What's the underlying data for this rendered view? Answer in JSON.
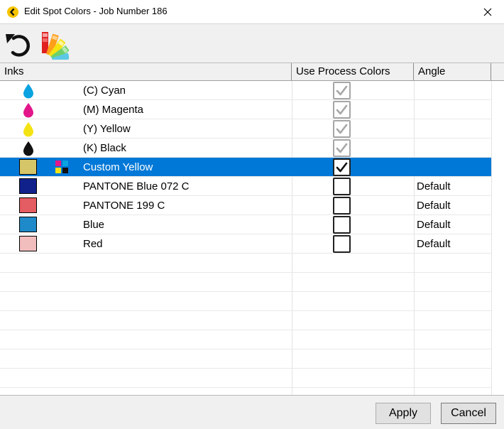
{
  "window": {
    "title": "Edit Spot Colors - Job Number 186",
    "app_icon": "kodak-logo-icon",
    "close_icon": "close-icon"
  },
  "toolbar": {
    "undo_icon": "undo-icon",
    "color_fan_icon": "color-fan-icon"
  },
  "table": {
    "columns": [
      "Inks",
      "Use Process Colors",
      "Angle"
    ],
    "rows": [
      {
        "name": "(C) Cyan",
        "kind": "drop",
        "color": "#0aa2e0",
        "use_process": true,
        "process_enabled": false,
        "angle": "",
        "selected": false
      },
      {
        "name": "(M) Magenta",
        "kind": "drop",
        "color": "#e2168a",
        "use_process": true,
        "process_enabled": false,
        "angle": "",
        "selected": false
      },
      {
        "name": "(Y) Yellow",
        "kind": "drop",
        "color": "#f4e313",
        "use_process": true,
        "process_enabled": false,
        "angle": "",
        "selected": false
      },
      {
        "name": "(K) Black",
        "kind": "drop",
        "color": "#111111",
        "use_process": true,
        "process_enabled": false,
        "angle": "",
        "selected": false
      },
      {
        "name": "Custom Yellow",
        "kind": "swatch",
        "color": "#d6c66a",
        "use_process": true,
        "process_enabled": true,
        "angle": "",
        "selected": true,
        "cmyk_icon": true
      },
      {
        "name": "PANTONE Blue 072 C",
        "kind": "swatch",
        "color": "#10218b",
        "use_process": false,
        "process_enabled": true,
        "angle": "Default",
        "selected": false
      },
      {
        "name": "PANTONE 199 C",
        "kind": "swatch",
        "color": "#e45d62",
        "use_process": false,
        "process_enabled": true,
        "angle": "Default",
        "selected": false
      },
      {
        "name": "Blue",
        "kind": "swatch",
        "color": "#1f8ac9",
        "use_process": false,
        "process_enabled": true,
        "angle": "Default",
        "selected": false
      },
      {
        "name": "Red",
        "kind": "swatch",
        "color": "#f2bdbd",
        "use_process": false,
        "process_enabled": true,
        "angle": "Default",
        "selected": false
      }
    ]
  },
  "buttons": {
    "apply": "Apply",
    "cancel": "Cancel"
  },
  "colors": {
    "selection": "#0078d7",
    "toolbar_bg": "#f0f0f0"
  }
}
